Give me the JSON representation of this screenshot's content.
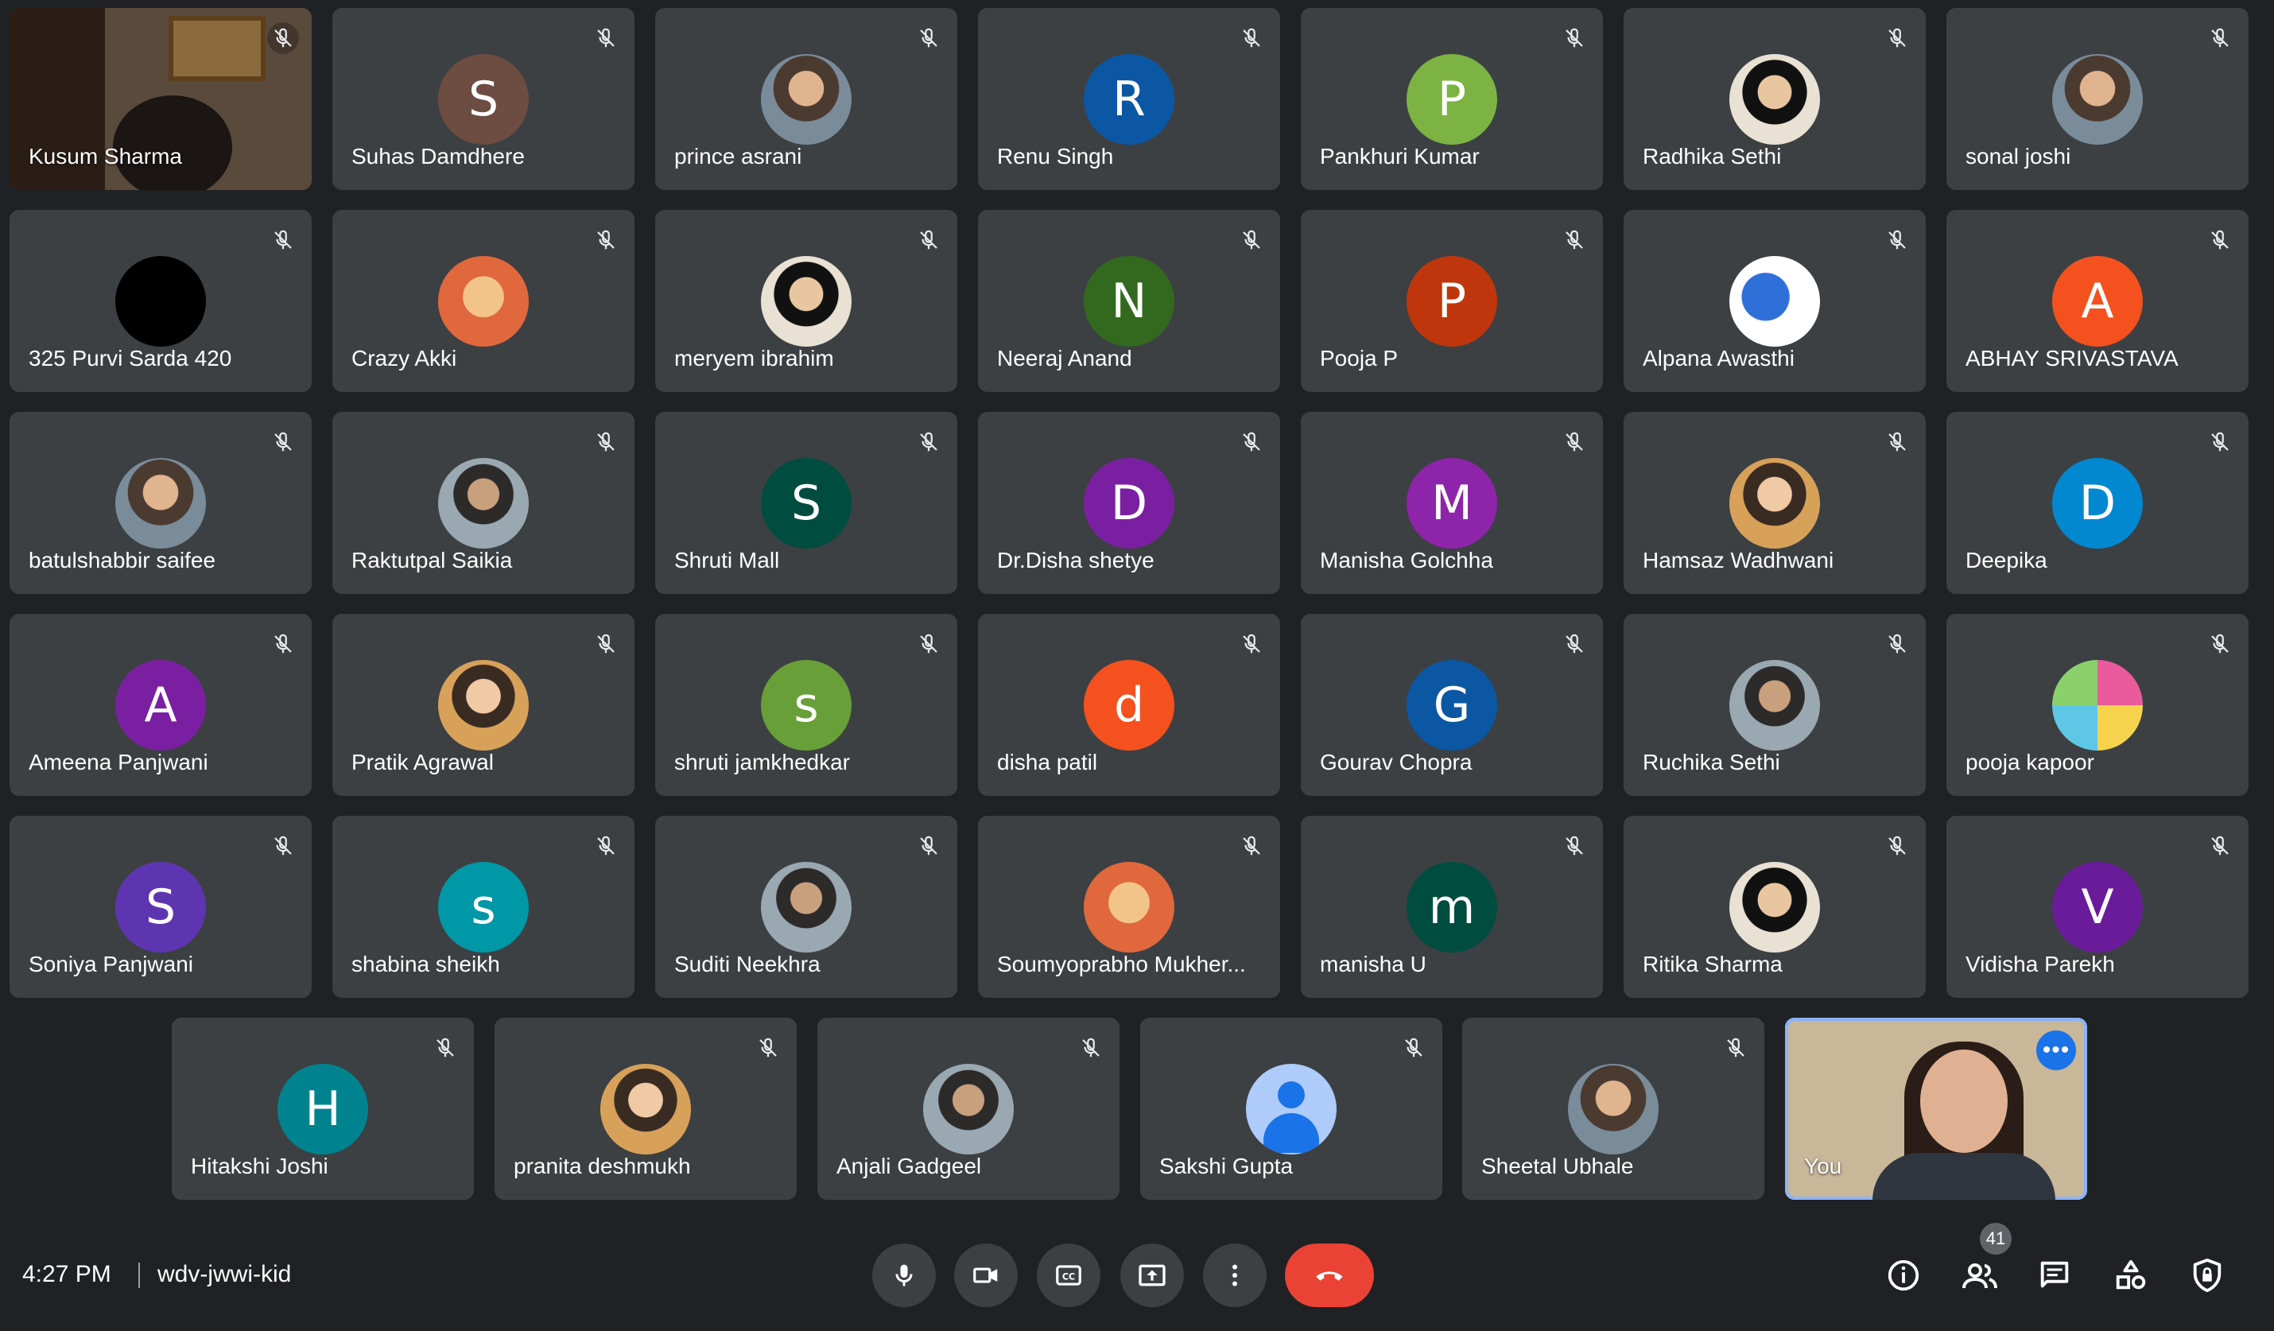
{
  "participants": [
    {
      "name": "Kusum Sharma",
      "type": "video",
      "bg": "kusum"
    },
    {
      "name": "Suhas Damdhere",
      "type": "letter",
      "letter": "S",
      "color": "#6d4c41"
    },
    {
      "name": "prince asrani",
      "type": "photo",
      "style": "photo"
    },
    {
      "name": "Renu Singh",
      "type": "letter",
      "letter": "R",
      "color": "#0b57a4"
    },
    {
      "name": "Pankhuri Kumar",
      "type": "letter",
      "letter": "P",
      "color": "#7cb342"
    },
    {
      "name": "Radhika Sethi",
      "type": "photo",
      "style": "photo4"
    },
    {
      "name": "sonal joshi",
      "type": "photo",
      "style": "photo"
    },
    {
      "name": "325 Purvi Sarda 420",
      "type": "photo",
      "style": "black"
    },
    {
      "name": "Crazy Akki",
      "type": "photo",
      "style": "cartoon"
    },
    {
      "name": "meryem ibrahim",
      "type": "photo",
      "style": "photo4"
    },
    {
      "name": "Neeraj Anand",
      "type": "letter",
      "letter": "N",
      "color": "#33691e"
    },
    {
      "name": "Pooja P",
      "type": "letter",
      "letter": "P",
      "color": "#bf360c"
    },
    {
      "name": "Alpana Awasthi",
      "type": "photo",
      "style": "brain"
    },
    {
      "name": "ABHAY SRIVASTAVA",
      "type": "letter",
      "letter": "A",
      "color": "#f4511e"
    },
    {
      "name": "batulshabbir saifee",
      "type": "photo",
      "style": "photo"
    },
    {
      "name": "Raktutpal Saikia",
      "type": "photo",
      "style": "photo2"
    },
    {
      "name": "Shruti Mall",
      "type": "letter",
      "letter": "S",
      "color": "#004d40"
    },
    {
      "name": "Dr.Disha shetye",
      "type": "letter",
      "letter": "D",
      "color": "#7b1fa2"
    },
    {
      "name": "Manisha Golchha",
      "type": "letter",
      "letter": "M",
      "color": "#8e24aa"
    },
    {
      "name": "Hamsaz Wadhwani",
      "type": "photo",
      "style": "photo3"
    },
    {
      "name": "Deepika",
      "type": "letter",
      "letter": "D",
      "color": "#0288d1"
    },
    {
      "name": "Ameena Panjwani",
      "type": "letter",
      "letter": "A",
      "color": "#7b1fa2"
    },
    {
      "name": "Pratik Agrawal",
      "type": "photo",
      "style": "photo3"
    },
    {
      "name": "shruti jamkhedkar",
      "type": "letter",
      "letter": "s",
      "color": "#689f38"
    },
    {
      "name": "disha patil",
      "type": "letter",
      "letter": "d",
      "color": "#f4511e"
    },
    {
      "name": "Gourav Chopra",
      "type": "letter",
      "letter": "G",
      "color": "#0b57a4"
    },
    {
      "name": "Ruchika Sethi",
      "type": "photo",
      "style": "photo2"
    },
    {
      "name": "pooja kapoor",
      "type": "photo",
      "style": "kite"
    },
    {
      "name": "Soniya Panjwani",
      "type": "letter",
      "letter": "S",
      "color": "#5e35b1"
    },
    {
      "name": "shabina sheikh",
      "type": "letter",
      "letter": "s",
      "color": "#0097a7"
    },
    {
      "name": "Suditi Neekhra",
      "type": "photo",
      "style": "photo2"
    },
    {
      "name": "Soumyoprabho Mukher...",
      "type": "photo",
      "style": "cartoon"
    },
    {
      "name": "manisha U",
      "type": "letter",
      "letter": "m",
      "color": "#004d40"
    },
    {
      "name": "Ritika Sharma",
      "type": "photo",
      "style": "photo4"
    },
    {
      "name": "Vidisha Parekh",
      "type": "letter",
      "letter": "V",
      "color": "#6a1b9a"
    },
    {
      "name": "Hitakshi Joshi",
      "type": "letter",
      "letter": "H",
      "color": "#00838f"
    },
    {
      "name": "pranita deshmukh",
      "type": "photo",
      "style": "photo3"
    },
    {
      "name": "Anjali Gadgeel",
      "type": "photo",
      "style": "photo2"
    },
    {
      "name": "Sakshi Gupta",
      "type": "person"
    },
    {
      "name": "Sheetal Ubhale",
      "type": "photo",
      "style": "photo"
    },
    {
      "name": "You",
      "type": "self"
    }
  ],
  "bottom_bar": {
    "time": "4:27 PM",
    "meeting_code": "wdv-jwwi-kid",
    "participant_count": "41",
    "colors": {
      "end_call": "#ea4335",
      "accent": "#8ab4f8"
    }
  }
}
